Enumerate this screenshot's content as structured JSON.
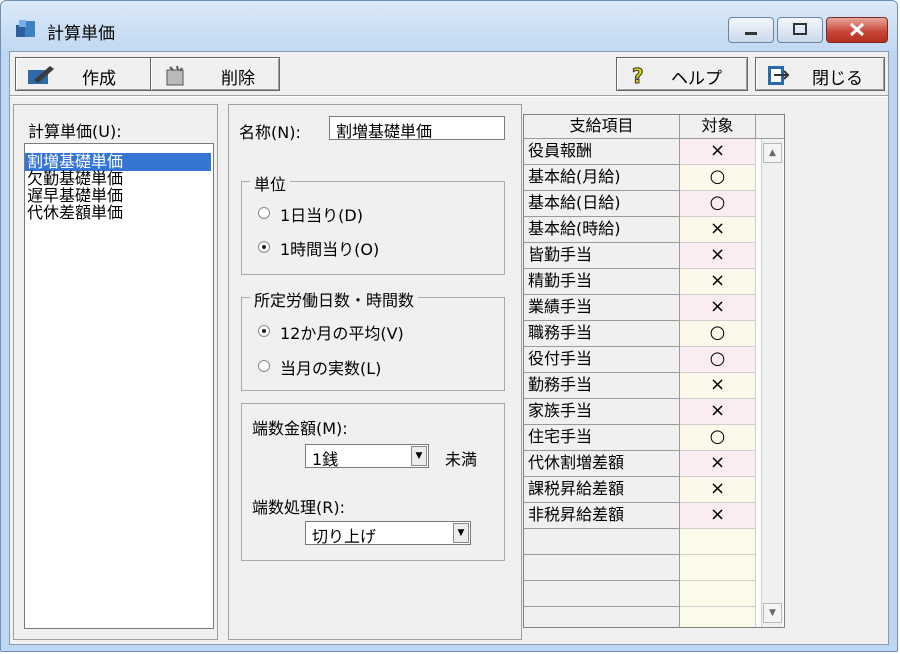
{
  "window": {
    "title": "計算単価"
  },
  "toolbar": {
    "create_label": "作成",
    "delete_label": "削除",
    "help_label": "ヘルプ",
    "close_label": "閉じる"
  },
  "list_panel": {
    "label": "計算単価(U):",
    "items": [
      "割増基礎単価",
      "欠勤基礎単価",
      "遅早基礎単価",
      "代休差額単価"
    ],
    "selected_index": 0
  },
  "form": {
    "name_label": "名称(N):",
    "name_value": "割増基礎単価",
    "unit_group": {
      "legend": "単位",
      "options": [
        "1日当り(D)",
        "1時間当り(O)"
      ],
      "selected_index": 1
    },
    "days_group": {
      "legend": "所定労働日数・時間数",
      "options": [
        "12か月の平均(V)",
        "当月の実数(L)"
      ],
      "selected_index": 0
    },
    "rounding": {
      "amount_label": "端数金額(M):",
      "amount_value": "1銭",
      "amount_suffix": "未満",
      "method_label": "端数処理(R):",
      "method_value": "切り上げ"
    }
  },
  "grid": {
    "headers": [
      "支給項目",
      "対象"
    ],
    "rows": [
      {
        "item": "役員報酬",
        "target": "×"
      },
      {
        "item": "基本給(月給)",
        "target": "○"
      },
      {
        "item": "基本給(日給)",
        "target": "○"
      },
      {
        "item": "基本給(時給)",
        "target": "×"
      },
      {
        "item": "皆勤手当",
        "target": "×"
      },
      {
        "item": "精勤手当",
        "target": "×"
      },
      {
        "item": "業績手当",
        "target": "×"
      },
      {
        "item": "職務手当",
        "target": "○"
      },
      {
        "item": "役付手当",
        "target": "○"
      },
      {
        "item": "勤務手当",
        "target": "×"
      },
      {
        "item": "家族手当",
        "target": "×"
      },
      {
        "item": "住宅手当",
        "target": "○"
      },
      {
        "item": "代休割増差額",
        "target": "×"
      },
      {
        "item": "課税昇給差額",
        "target": "×"
      },
      {
        "item": "非税昇給差額",
        "target": "×"
      }
    ],
    "empty_rows": 4
  },
  "colors": {
    "selection": "#3575d3",
    "row_even": "#fcf9ea",
    "row_odd": "#fbecf2",
    "row_empty": "#fcfbe9",
    "frame": "#bdd7f3"
  },
  "icons": [
    "app-icon",
    "edit-icon",
    "trash-icon",
    "help-icon",
    "exit-icon",
    "minimize-icon",
    "maximize-icon",
    "close-icon",
    "scroll-up-icon",
    "scroll-down-icon",
    "dropdown-arrow-icon"
  ]
}
